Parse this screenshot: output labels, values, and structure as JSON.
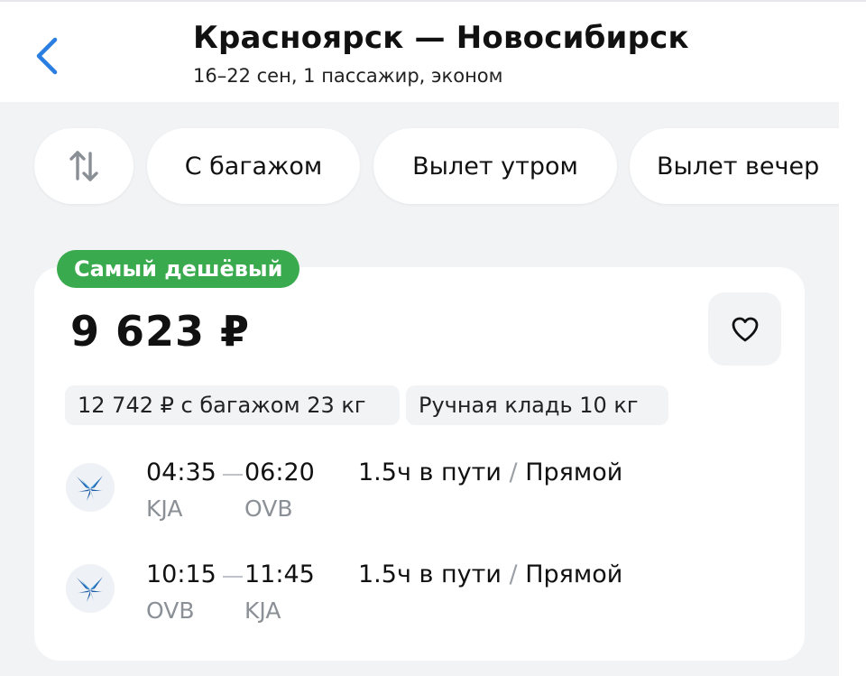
{
  "header": {
    "title": "Красноярск — Новосибирск",
    "subtitle": "16–22 сен, 1 пассажир, эконом"
  },
  "filters": [
    {
      "label": "С багажом"
    },
    {
      "label": "Вылет утром"
    },
    {
      "label": "Вылет вечер"
    }
  ],
  "icons": {
    "back": "chevron-left-icon",
    "sort": "sort-arrows-icon",
    "favorite": "heart-icon",
    "airline": "airline-bird-logo"
  },
  "colors": {
    "accent": "#2a7de1",
    "badge": "#3aaa4e",
    "page_bg": "#f2f3f5"
  },
  "offer": {
    "badge": "Самый дешёвый",
    "price": "9 623 ₽",
    "baggage_price": "12 742 ₽ с багажом 23 кг",
    "hand_luggage": "Ручная кладь 10 кг",
    "segments": [
      {
        "dep_time": "04:35",
        "arr_time": "06:20",
        "dep_code": "KJA",
        "arr_code": "OVB",
        "duration": "1.5ч в пути",
        "separator": "/",
        "type": "Прямой"
      },
      {
        "dep_time": "10:15",
        "arr_time": "11:45",
        "dep_code": "OVB",
        "arr_code": "KJA",
        "duration": "1.5ч в пути",
        "separator": "/",
        "type": "Прямой"
      }
    ]
  }
}
